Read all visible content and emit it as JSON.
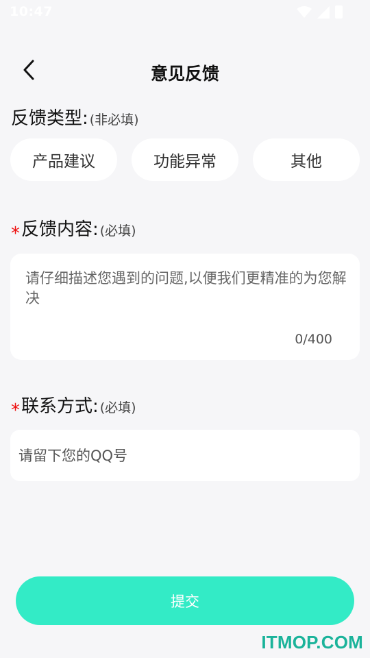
{
  "status_bar": {
    "time": "10:47"
  },
  "header": {
    "title": "意见反馈",
    "back_icon": "chevron-left-icon"
  },
  "feedback_type": {
    "label": "反馈类型:",
    "note": "(非必填)",
    "options": [
      "产品建议",
      "功能异常",
      "其他"
    ]
  },
  "feedback_content": {
    "required_mark": "*",
    "label": "反馈内容:",
    "note": "(必填)",
    "placeholder": "请仔细描述您遇到的问题,以便我们更精准的为您解决",
    "value": "",
    "counter": "0/400"
  },
  "contact": {
    "required_mark": "*",
    "label": "联系方式:",
    "note": "(必填)",
    "placeholder": "请留下您的QQ号",
    "value": ""
  },
  "submit": {
    "label": "提交"
  },
  "watermark": {
    "text": "ITMOP.COM"
  },
  "colors": {
    "accent": "#33ebc6",
    "background": "#f6f6f8",
    "required": "#ee1111",
    "watermark": "#1ab39a"
  }
}
